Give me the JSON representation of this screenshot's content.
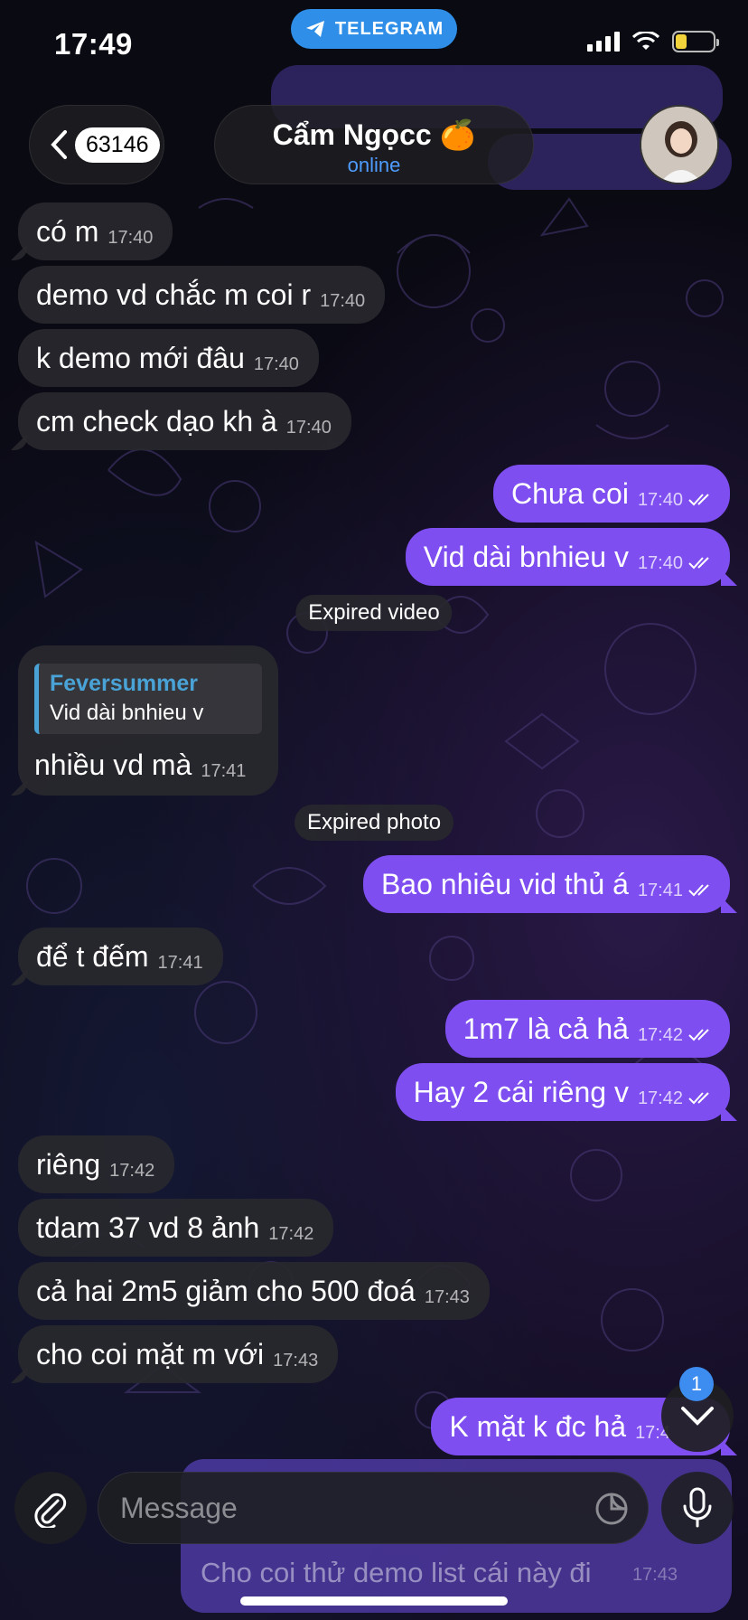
{
  "status_bar": {
    "time": "17:49",
    "app_pill": "TELEGRAM",
    "battery_level": 0.3
  },
  "header": {
    "back_count": "63146",
    "contact_name": "Cẩm Ngọcc 🍊",
    "contact_status": "online"
  },
  "messages": [
    {
      "dir": "in",
      "text": "có m",
      "time": "17:40"
    },
    {
      "dir": "in",
      "text": "demo vd chắc m coi r",
      "time": "17:40"
    },
    {
      "dir": "in",
      "text": "k demo mới đâu",
      "time": "17:40"
    },
    {
      "dir": "in",
      "text": "cm check dạo kh à",
      "time": "17:40"
    },
    {
      "dir": "out",
      "text": "Chưa coi",
      "time": "17:40"
    },
    {
      "dir": "out",
      "text": "Vid dài bnhieu v",
      "time": "17:40"
    },
    {
      "dir": "in",
      "text": "nhiều vd mà",
      "time": "17:41",
      "reply_name": "Feversummer",
      "reply_text": "Vid dài bnhieu v"
    },
    {
      "dir": "out",
      "text": "Bao nhiêu vid thủ á",
      "time": "17:41"
    },
    {
      "dir": "in",
      "text": "để t đếm",
      "time": "17:41"
    },
    {
      "dir": "out",
      "text": "1m7 là cả hả",
      "time": "17:42"
    },
    {
      "dir": "out",
      "text": "Hay 2 cái riêng v",
      "time": "17:42"
    },
    {
      "dir": "in",
      "text": "riêng",
      "time": "17:42"
    },
    {
      "dir": "in",
      "text": "tdam 37 vd 8 ảnh",
      "time": "17:42"
    },
    {
      "dir": "in",
      "text": "cả hai 2m5 giảm cho 500 đoá",
      "time": "17:43"
    },
    {
      "dir": "in",
      "text": "cho coi mặt m với",
      "time": "17:43"
    },
    {
      "dir": "out",
      "text": "K mặt k đc hả",
      "time": "17:4"
    }
  ],
  "system": {
    "expired_video": "Expired video",
    "expired_photo": "Expired photo"
  },
  "composer": {
    "placeholder": "Message",
    "ghost_text": "Cho coi thử demo list cái này đi",
    "ghost_time": "17:43"
  },
  "scroll_badge": "1",
  "colors": {
    "outgoing": "#7e4ef0",
    "incoming": "#28282e",
    "accent": "#4f9cff",
    "telegram": "#2f8fe8"
  }
}
